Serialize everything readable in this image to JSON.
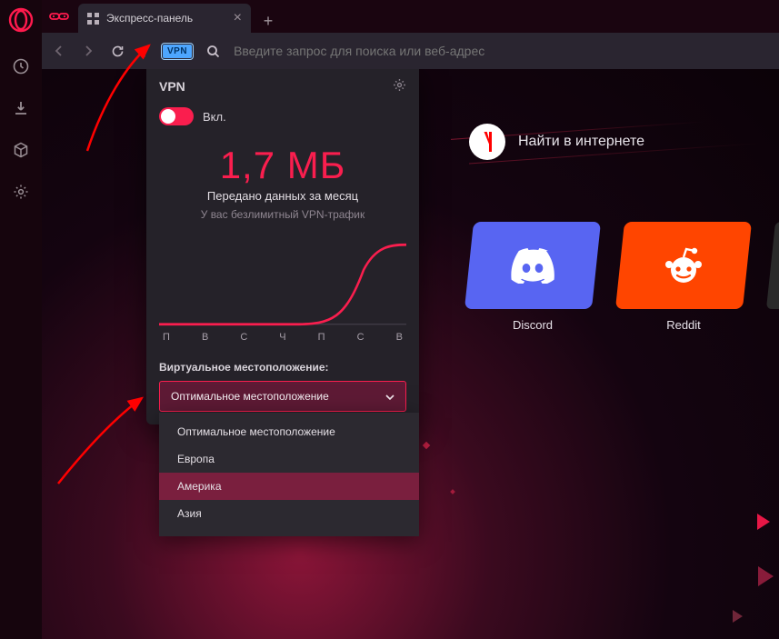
{
  "sidebar": {
    "items": [
      "history-icon",
      "downloads-icon",
      "cube-icon",
      "settings-gear-icon"
    ]
  },
  "tab": {
    "title": "Экспресс-панель"
  },
  "addressbar": {
    "vpn_badge": "VPN",
    "placeholder": "Введите запрос для поиска или веб-адрес"
  },
  "speeddial": {
    "search_label": "Найти в интернете",
    "yandex_letter": "Я",
    "tiles": [
      {
        "name": "Discord",
        "color": "#5865f2"
      },
      {
        "name": "Reddit",
        "color": "#ff4500"
      }
    ]
  },
  "vpn": {
    "title": "VPN",
    "on_label": "Вкл.",
    "data_amount": "1,7 МБ",
    "data_caption": "Передано данных за месяц",
    "unlimited_note": "У вас безлимитный VPN-трафик",
    "days": [
      "П",
      "В",
      "С",
      "Ч",
      "П",
      "С",
      "В"
    ],
    "location_label": "Виртуальное местоположение:",
    "selected": "Оптимальное местоположение",
    "options": [
      "Оптимальное местоположение",
      "Европа",
      "Америка",
      "Азия"
    ],
    "highlighted_option_index": 2
  },
  "chart_data": {
    "type": "area",
    "categories": [
      "П",
      "В",
      "С",
      "Ч",
      "П",
      "С",
      "В"
    ],
    "values": [
      0,
      0,
      0,
      0,
      0.02,
      0.45,
      1.7
    ],
    "title": "Передано данных за месяц",
    "ylabel": "МБ",
    "ylim": [
      0,
      1.7
    ]
  }
}
